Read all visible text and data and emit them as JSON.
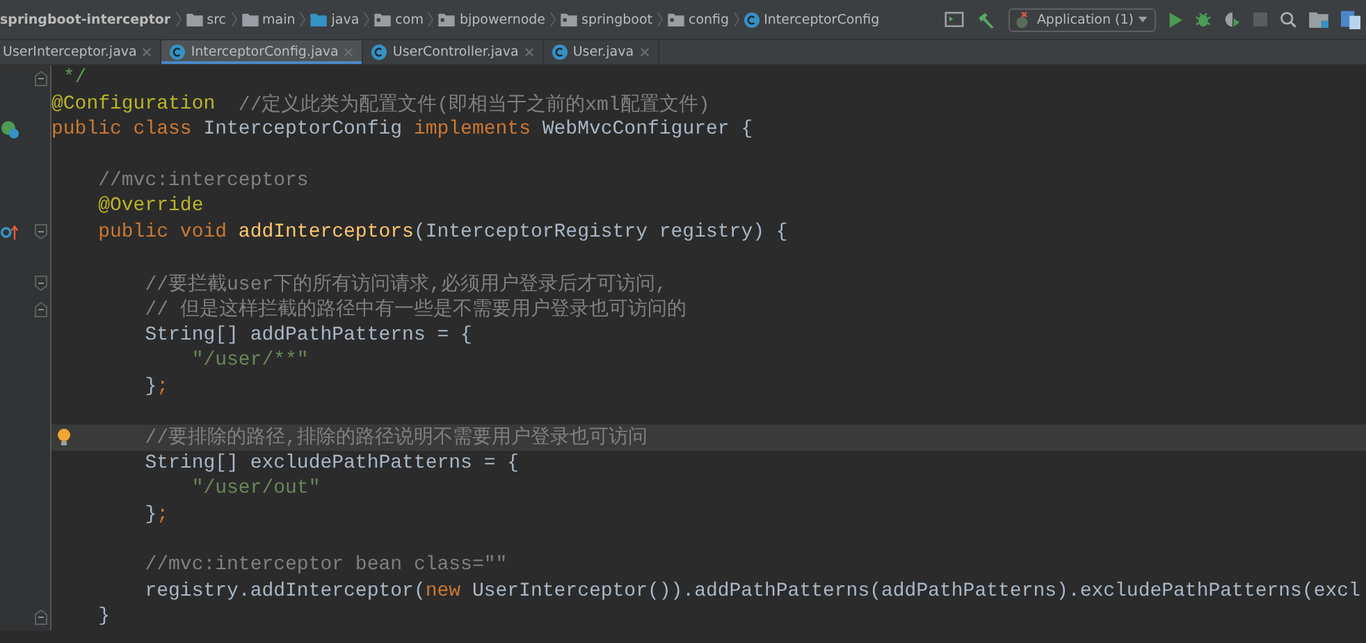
{
  "breadcrumb": [
    {
      "label": "springboot-interceptor",
      "kind": "project"
    },
    {
      "label": "src",
      "kind": "folder"
    },
    {
      "label": "main",
      "kind": "folder"
    },
    {
      "label": "java",
      "kind": "source"
    },
    {
      "label": "com",
      "kind": "package"
    },
    {
      "label": "bjpowernode",
      "kind": "package"
    },
    {
      "label": "springboot",
      "kind": "package"
    },
    {
      "label": "config",
      "kind": "package"
    },
    {
      "label": "InterceptorConfig",
      "kind": "class"
    }
  ],
  "toolbar": {
    "run_config": "Application (1)"
  },
  "tabs": [
    {
      "label": "UserInterceptor.java",
      "selected": false
    },
    {
      "label": "InterceptorConfig.java",
      "selected": true
    },
    {
      "label": "UserController.java",
      "selected": false
    },
    {
      "label": "User.java",
      "selected": false
    }
  ],
  "editor": {
    "lines": [
      {
        "fold_marker": {
          "kind": "end"
        },
        "tokens": [
          {
            "t": " */",
            "kind": "doc"
          }
        ]
      },
      {
        "tokens": [
          {
            "t": "@Configuration",
            "kind": "annotation"
          },
          {
            "t": "  //定义此类为配置文件(即相当于之前的xml配置文件)",
            "kind": "comment"
          }
        ]
      },
      {
        "gutter_icon": {
          "kind": "bean"
        },
        "tokens": [
          {
            "t": "public class ",
            "kind": "keyword"
          },
          {
            "t": "InterceptorConfig ",
            "kind": "plain"
          },
          {
            "t": "implements ",
            "kind": "keyword"
          },
          {
            "t": "WebMvcConfigurer {",
            "kind": "plain"
          }
        ]
      },
      {
        "blank_before": true,
        "tokens": [
          {
            "t": "    //mvc:interceptors",
            "kind": "comment"
          }
        ]
      },
      {
        "tokens": [
          {
            "t": "    @Override",
            "kind": "annotation"
          }
        ]
      },
      {
        "gutter_icon": {
          "kind": "override"
        },
        "fold_marker": {
          "kind": "start"
        },
        "tokens": [
          {
            "t": "    public void ",
            "kind": "keyword"
          },
          {
            "t": "addInterceptors",
            "kind": "method"
          },
          {
            "t": "(InterceptorRegistry registry) {",
            "kind": "plain"
          }
        ]
      },
      {
        "blank_before": true,
        "fold_marker": {
          "kind": "start"
        },
        "tokens": [
          {
            "t": "        //要拦截user下的所有访问请求,必须用户登录后才可访问,",
            "kind": "comment"
          }
        ]
      },
      {
        "fold_marker": {
          "kind": "end"
        },
        "tokens": [
          {
            "t": "        // 但是这样拦截的路径中有一些是不需要用户登录也可访问的",
            "kind": "comment"
          }
        ]
      },
      {
        "tokens": [
          {
            "t": "        String[] addPathPatterns = {",
            "kind": "plain"
          }
        ]
      },
      {
        "tokens": [
          {
            "t": "            \"/user/**\"",
            "kind": "string"
          }
        ]
      },
      {
        "tokens": [
          {
            "t": "        }",
            "kind": "plain"
          },
          {
            "t": ";",
            "kind": "keyword"
          }
        ]
      },
      {
        "blank_before": true,
        "current": true,
        "gutter_icon": {
          "kind": "bulb"
        },
        "tokens": [
          {
            "t": "        //要排除的路径,排除的路径说明不需要用户登录也可访问",
            "kind": "comment"
          }
        ]
      },
      {
        "tokens": [
          {
            "t": "        String[] excludePathPatterns = {",
            "kind": "plain"
          }
        ]
      },
      {
        "tokens": [
          {
            "t": "            \"/user/out\"",
            "kind": "string"
          }
        ]
      },
      {
        "tokens": [
          {
            "t": "        }",
            "kind": "plain"
          },
          {
            "t": ";",
            "kind": "keyword"
          }
        ]
      },
      {
        "blank_before": true,
        "tokens": [
          {
            "t": "        //mvc:interceptor bean class=\"\"",
            "kind": "comment"
          }
        ]
      },
      {
        "tokens": [
          {
            "t": "        registry.addInterceptor(",
            "kind": "plain"
          },
          {
            "t": "new ",
            "kind": "keyword"
          },
          {
            "t": "UserInterceptor()).addPathPatterns(addPathPatterns).excludePathPatterns(excl",
            "kind": "plain"
          }
        ]
      },
      {
        "fold_marker": {
          "kind": "end"
        },
        "tokens": [
          {
            "t": "    }",
            "kind": "plain"
          }
        ]
      }
    ]
  }
}
